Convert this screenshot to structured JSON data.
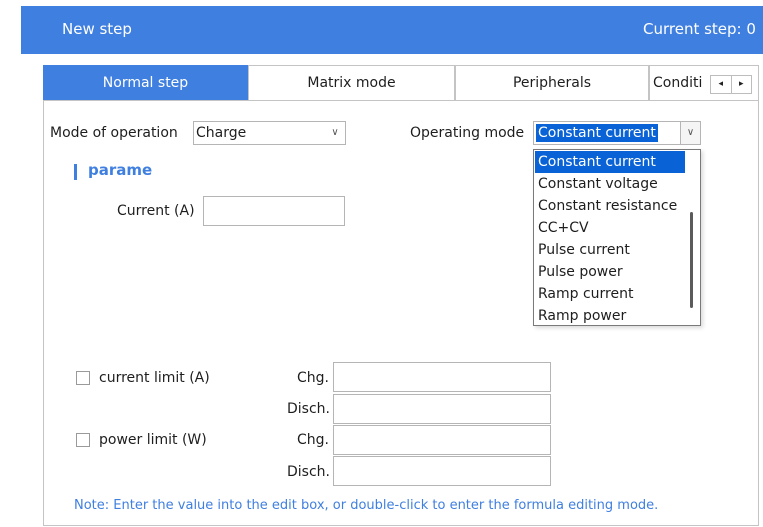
{
  "window": {
    "title": "New step",
    "current_step": "Current step: 0"
  },
  "tabs": [
    "Normal step",
    "Matrix mode",
    "Peripherals",
    "Conditi"
  ],
  "tab_scroll": {
    "left": "◂",
    "right": "▸"
  },
  "form": {
    "mode_label": "Mode of operation",
    "mode_value": "Charge",
    "operating_label": "Operating mode",
    "operating_value": "Constant current",
    "section_title": "parame",
    "current_label": "Current (A)",
    "current_value": ""
  },
  "dropdown_options": [
    "Constant current",
    "Constant voltage",
    "Constant resistance",
    "CC+CV",
    "Pulse current",
    "Pulse power",
    "Ramp current",
    "Ramp power"
  ],
  "limits": {
    "current_limit_label": "current limit (A)",
    "power_limit_label": "power limit (W)",
    "chg_label": "Chg.",
    "disch_label": "Disch."
  },
  "note": "Note: Enter the value into the edit box, or double-click to enter the formula editing mode.",
  "icons": {
    "chevron": "chevron-down-icon"
  },
  "colors": {
    "accent": "#3f7fe0",
    "selection": "#0a63d6"
  }
}
